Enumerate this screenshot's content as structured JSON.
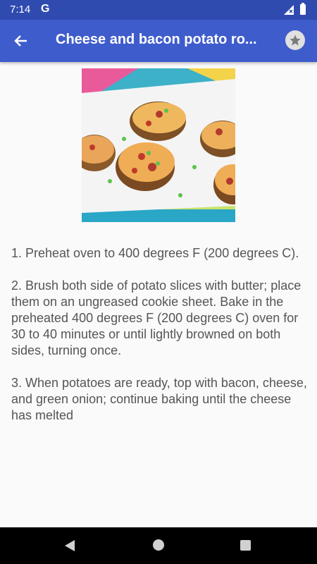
{
  "status_bar": {
    "time": "7:14",
    "google_indicator": "G",
    "icons": [
      "signal-icon",
      "battery-icon"
    ]
  },
  "app_bar": {
    "back_icon": "arrow-left-icon",
    "title": "Cheese and bacon potato ro...",
    "favorite_icon": "star-icon"
  },
  "recipe": {
    "image_subject": "food-photo",
    "steps": [
      "1. Preheat oven to 400 degrees F (200 degrees C).",
      "2. Brush both side of potato slices with butter; place them on an ungreased cookie sheet. Bake in the preheated 400 degrees F (200 degrees C) oven for 30 to 40 minutes or until lightly browned on both sides, turning once.",
      "3. When potatoes are ready, top with bacon, cheese, and green onion; continue baking until the cheese has melted"
    ]
  },
  "nav_bar": {
    "icons": [
      "nav-back-icon",
      "nav-home-icon",
      "nav-recents-icon"
    ]
  },
  "colors": {
    "app_bar": "#3f5ccc",
    "status_bar": "#2f4bb0",
    "body_text": "#555555",
    "background": "#fafafa"
  }
}
